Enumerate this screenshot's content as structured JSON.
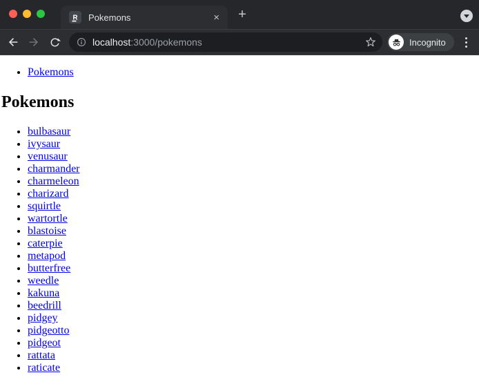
{
  "window": {
    "traffic_lights": {
      "close_color": "#FF5F57",
      "minimize_color": "#FEBC2E",
      "zoom_color": "#28C840"
    }
  },
  "tab_strip": {
    "active_tab": {
      "title": "Pokemons",
      "favicon": "remix-r-logo",
      "close_icon": "×"
    },
    "new_tab_icon": "+",
    "tab_search_icon": "chevron-down-in-circle"
  },
  "toolbar": {
    "back_icon": "arrow-left",
    "forward_icon": "arrow-right",
    "reload_icon": "reload-circular-arrow",
    "omnibox": {
      "info_icon": "info-circle",
      "url_host": "localhost",
      "url_rest": ":3000/pokemons",
      "bookmark_icon": "star-outline"
    },
    "incognito": {
      "label": "Incognito",
      "icon": "incognito-hat-glasses"
    },
    "menu_icon": "vertical-three-dots"
  },
  "page": {
    "nav": {
      "items": [
        {
          "label": "Pokemons"
        }
      ]
    },
    "heading": "Pokemons",
    "pokemons": [
      "bulbasaur",
      "ivysaur",
      "venusaur",
      "charmander",
      "charmeleon",
      "charizard",
      "squirtle",
      "wartortle",
      "blastoise",
      "caterpie",
      "metapod",
      "butterfree",
      "weedle",
      "kakuna",
      "beedrill",
      "pidgey",
      "pidgeotto",
      "pidgeot",
      "rattata",
      "raticate"
    ]
  },
  "colors": {
    "frame": "#26272a",
    "tab_toolbar": "#2d2e32",
    "omnibox": "#1d1e21",
    "incognito_pill": "#3c4043",
    "link": "#0000EE",
    "primary_text": "#e8eaed",
    "secondary_text": "#9aa0a6"
  }
}
